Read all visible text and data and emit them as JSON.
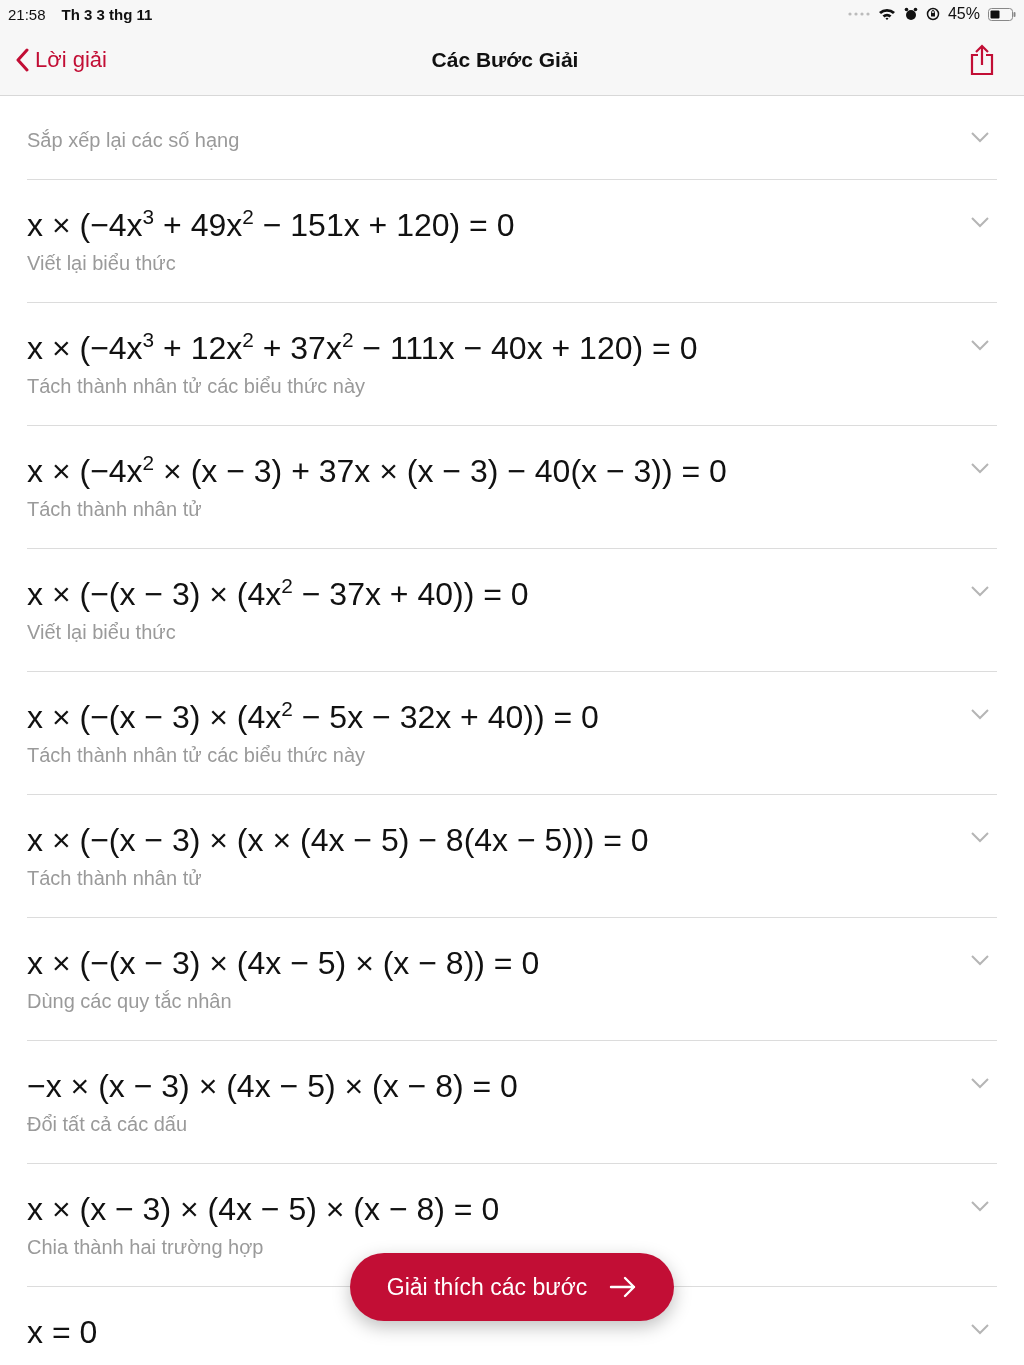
{
  "status_bar": {
    "time": "21:58",
    "date": "Th 3 3 thg 11",
    "battery": "45%"
  },
  "nav": {
    "back_label": "Lời giải",
    "title": "Các Bước Giải"
  },
  "steps": [
    {
      "description": "Sắp xếp lại các số hạng"
    },
    {
      "expression": "x × (−4x$^{3}$ + 49x$^{2}$ − 151x + 120) = 0",
      "description": "Viết lại biểu thức"
    },
    {
      "expression": "x × (−4x$^{3}$ + 12x$^{2}$ + 37x$^{2}$ − 111x − 40x + 120) = 0",
      "description": "Tách thành nhân tử các biểu thức này"
    },
    {
      "expression": "x × (−4x$^{2}$ × (x − 3) + 37x × (x − 3) − 40(x − 3)) = 0",
      "description": "Tách thành nhân tử"
    },
    {
      "expression": "x × (−(x − 3) × (4x$^{2}$ − 37x + 40)) = 0",
      "description": "Viết lại biểu thức"
    },
    {
      "expression": "x × (−(x − 3) × (4x$^{2}$ − 5x − 32x + 40)) = 0",
      "description": "Tách thành nhân tử các biểu thức này"
    },
    {
      "expression": "x × (−(x − 3) × (x × (4x − 5) − 8(4x − 5))) = 0",
      "description": "Tách thành nhân tử"
    },
    {
      "expression": "x × (−(x − 3) × (4x − 5) × (x − 8)) = 0",
      "description": "Dùng các quy tắc nhân"
    },
    {
      "expression": "−x × (x − 3) × (4x − 5) × (x − 8) = 0",
      "description": "Đổi tất cả các dấu"
    },
    {
      "expression": "x × (x − 3) × (4x − 5) × (x − 8) = 0",
      "description": "Chia thành hai trường hợp"
    },
    {
      "expression": "x = 0"
    }
  ],
  "action_button": {
    "label": "Giải thích các bước"
  }
}
